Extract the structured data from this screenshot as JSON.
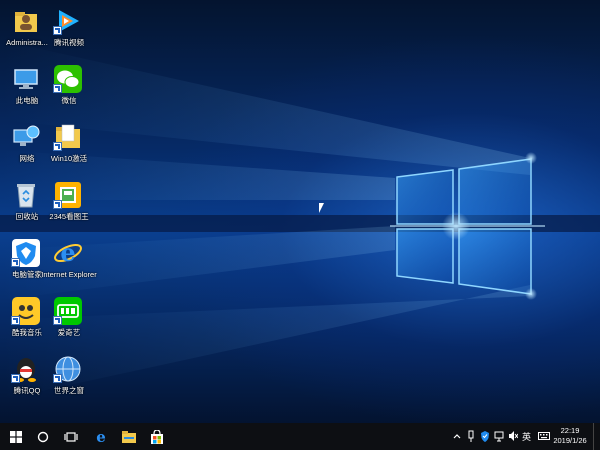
{
  "desktop": {
    "icons": [
      {
        "label": "Administra...",
        "icon": "user-folder-icon"
      },
      {
        "label": "腾讯视频",
        "icon": "tencent-video-icon"
      },
      {
        "label": "此电脑",
        "icon": "computer-icon"
      },
      {
        "label": "微信",
        "icon": "wechat-icon"
      },
      {
        "label": "网络",
        "icon": "network-icon"
      },
      {
        "label": "Win10激活",
        "icon": "folder-icon"
      },
      {
        "label": "回收站",
        "icon": "recycle-bin-icon"
      },
      {
        "label": "2345看图王",
        "icon": "image-viewer-icon"
      },
      {
        "label": "电脑管家",
        "icon": "pc-manager-icon"
      },
      {
        "label": "Internet Explorer",
        "icon": "ie-icon"
      },
      {
        "label": "酷我音乐",
        "icon": "kuwo-music-icon"
      },
      {
        "label": "爱奇艺",
        "icon": "iqiyi-icon"
      },
      {
        "label": "腾讯QQ",
        "icon": "qq-icon"
      },
      {
        "label": "世界之窗",
        "icon": "world-window-browser-icon"
      }
    ]
  },
  "taskbar": {
    "start": "start-icon",
    "search": "search-circle-icon",
    "task_view": "task-view-icon",
    "pinned": [
      "edge-icon",
      "file-explorer-icon",
      "store-icon"
    ],
    "tray": {
      "ime_label": "英",
      "time": "22:19",
      "date": "2019/1/26"
    }
  },
  "colors": {
    "taskbar_bg": "#0d0f13",
    "wallpaper_blue": "#0a3f8f",
    "light_blue": "#7fd0ff"
  }
}
